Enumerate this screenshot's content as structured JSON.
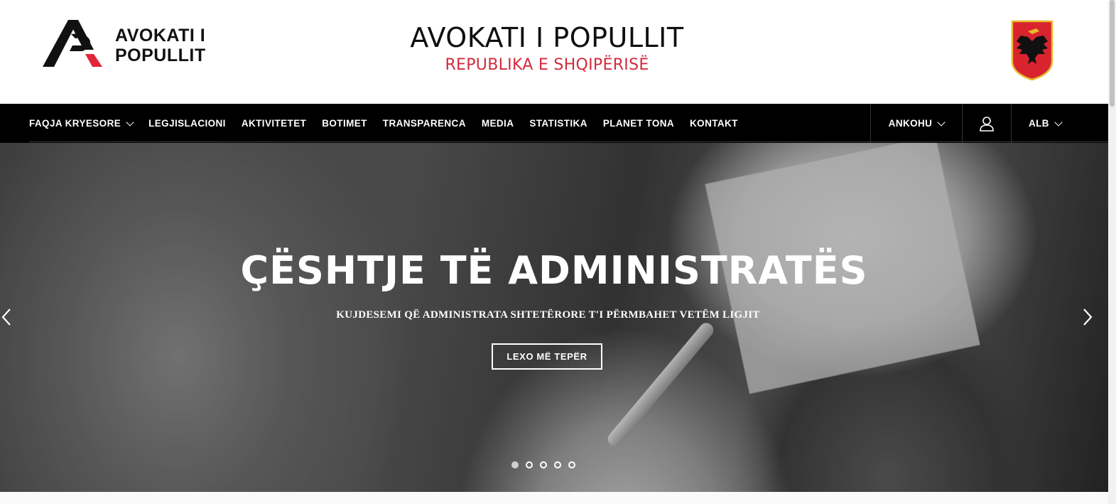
{
  "header": {
    "logo_line1": "AVOKATI I",
    "logo_line2": "POPULLIT",
    "title": "AVOKATI I POPULLIT",
    "subtitle": "REPUBLIKA E SHQIPËRISË",
    "accent_color": "#d22b3c"
  },
  "nav": {
    "items": [
      {
        "label": "FAQJA KRYESORE",
        "has_dropdown": true
      },
      {
        "label": "LEGJISLACIONI"
      },
      {
        "label": "AKTIVITETET"
      },
      {
        "label": "BOTIMET"
      },
      {
        "label": "TRANSPARENCA"
      },
      {
        "label": "MEDIA"
      },
      {
        "label": "STATISTIKA"
      },
      {
        "label": "PLANET TONA"
      },
      {
        "label": "KONTAKT"
      }
    ],
    "complaint_label": "ANKOHU",
    "user_icon": "user-icon",
    "language_label": "ALB"
  },
  "hero": {
    "title": "ÇËSHTJE TË ADMINISTRATËS",
    "subtitle": "KUJDESEMI QË ADMINISTRATA SHTETËRORE T'I PËRMBAHET VETËM LIGJIT",
    "button_label": "LEXO MË TEPËR",
    "slides_count": 5,
    "active_slide": 1
  }
}
